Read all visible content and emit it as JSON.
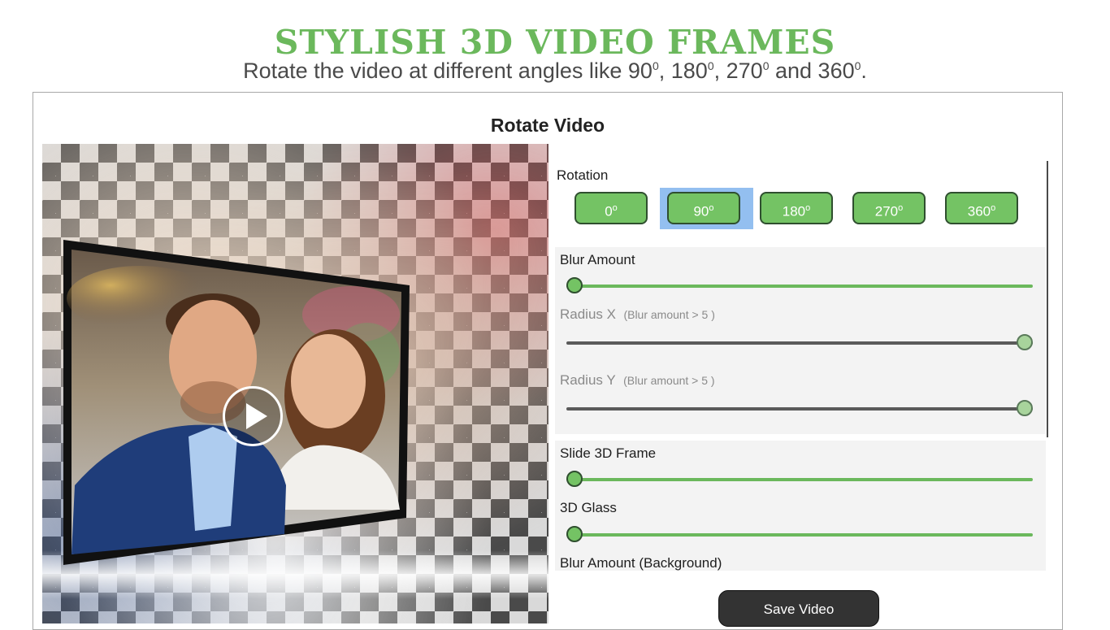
{
  "promo": {
    "headline": "STYLISH 3D VIDEO FRAMES",
    "subline_prefix": "Rotate the video at different angles like ",
    "subline_sep": ", ",
    "subline_and": " and ",
    "subline_suffix": ".",
    "angles": [
      "90",
      "180",
      "270",
      "360"
    ],
    "degree_mark": "0"
  },
  "window": {
    "title": "Rotate Video"
  },
  "preview": {
    "play_icon": "play-icon"
  },
  "controls": {
    "rotation_label": "Rotation",
    "rotation_buttons": [
      {
        "value": "0",
        "mark": "o"
      },
      {
        "value": "90",
        "mark": "o"
      },
      {
        "value": "180",
        "mark": "o"
      },
      {
        "value": "270",
        "mark": "o"
      },
      {
        "value": "360",
        "mark": "o"
      }
    ],
    "selected_rotation": "90",
    "blur_amount": {
      "label": "Blur Amount",
      "value": 0
    },
    "radius_x": {
      "label": "Radius X",
      "hint": "(Blur amount > 5 )",
      "value": 1,
      "enabled": false
    },
    "radius_y": {
      "label": "Radius Y",
      "hint": "(Blur amount > 5 )",
      "value": 1,
      "enabled": false
    },
    "slide_3d_frame": {
      "label": "Slide 3D Frame",
      "value": 0
    },
    "glass_3d": {
      "label": "3D Glass",
      "value": 0
    },
    "blur_background": {
      "label": "Blur Amount (Background)"
    },
    "save_label": "Save Video"
  },
  "colors": {
    "accent_green": "#6bb85c",
    "button_green": "#74c364",
    "selected_highlight": "#93bff0",
    "disabled_track": "#5a5a5a",
    "dark_button": "#333333"
  }
}
